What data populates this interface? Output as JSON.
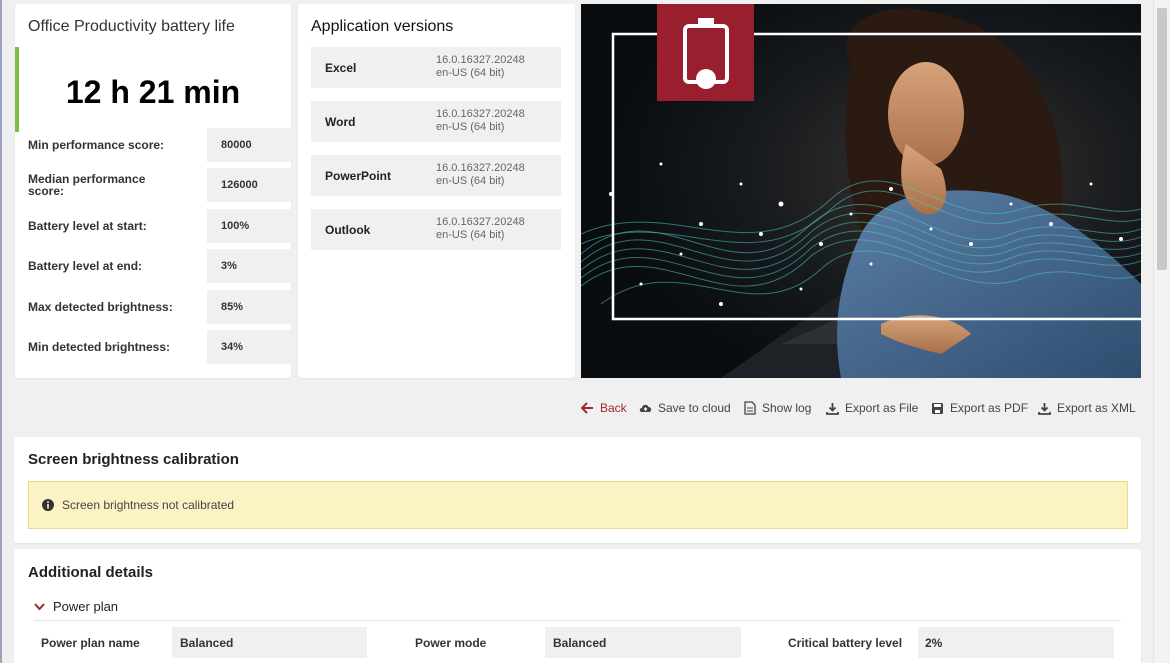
{
  "battery": {
    "title": "Office Productivity battery life",
    "time": "12 h 21 min",
    "metrics": [
      {
        "label": "Min performance score:",
        "value": "80000"
      },
      {
        "label": "Median performance score:",
        "value": "126000"
      },
      {
        "label": "Battery level at start:",
        "value": "100%"
      },
      {
        "label": "Battery level at end:",
        "value": "3%"
      },
      {
        "label": "Max detected brightness:",
        "value": "85%"
      },
      {
        "label": "Min detected brightness:",
        "value": "34%"
      }
    ]
  },
  "apps": {
    "title": "Application versions",
    "items": [
      {
        "name": "Excel",
        "version": "16.0.16327.20248",
        "locale": "en-US (64 bit)"
      },
      {
        "name": "Word",
        "version": "16.0.16327.20248",
        "locale": "en-US (64 bit)"
      },
      {
        "name": "PowerPoint",
        "version": "16.0.16327.20248",
        "locale": "en-US (64 bit)"
      },
      {
        "name": "Outlook",
        "version": "16.0.16327.20248",
        "locale": "en-US (64 bit)"
      }
    ]
  },
  "hero": {
    "icon": "battery-icon",
    "accent": "#9a1f2e"
  },
  "toolbar": {
    "back": "Back",
    "save_cloud": "Save to cloud",
    "show_log": "Show log",
    "export_file": "Export as File",
    "export_pdf": "Export as PDF",
    "export_xml": "Export as XML"
  },
  "calibration": {
    "title": "Screen brightness calibration",
    "message": "Screen brightness not calibrated"
  },
  "details": {
    "title": "Additional details",
    "section": "Power plan",
    "rows": [
      {
        "label": "Power plan name",
        "value": "Balanced"
      },
      {
        "label": "Power mode",
        "value": "Balanced"
      },
      {
        "label": "Critical battery level",
        "value": "2%"
      }
    ]
  },
  "colors": {
    "accent_green": "#7ac143",
    "accent_red": "#a0282e",
    "warning_bg": "#fbf3c4"
  }
}
